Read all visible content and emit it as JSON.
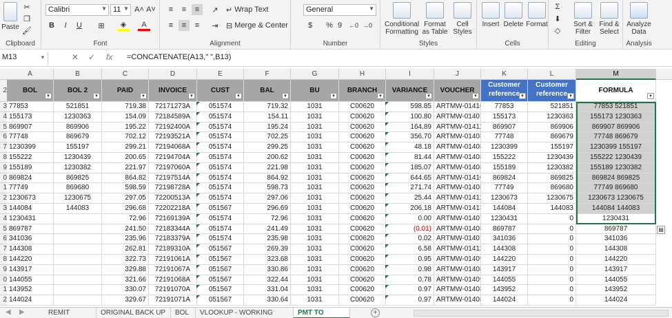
{
  "ribbon": {
    "clipboard": {
      "paste": "Paste",
      "label": "Clipboard"
    },
    "font": {
      "name": "Calibri",
      "size": "11",
      "grow": "A˄",
      "shrink": "A˅",
      "bold": "B",
      "italic": "I",
      "underline": "U",
      "label": "Font"
    },
    "alignment": {
      "wrap": "Wrap Text",
      "merge": "Merge & Center",
      "label": "Alignment"
    },
    "number": {
      "format": "General",
      "currency": "$",
      "percent": "%",
      "comma": "9",
      "label": "Number"
    },
    "styles": {
      "conditional": "Conditional Formatting",
      "table": "Format as Table",
      "cell": "Cell Styles",
      "label": "Styles"
    },
    "cells": {
      "insert": "Insert",
      "delete": "Delete",
      "format": "Format",
      "label": "Cells"
    },
    "editing": {
      "sort": "Sort & Filter",
      "find": "Find & Select",
      "label": "Editing"
    },
    "analysis": {
      "analyze": "Analyze Data",
      "label": "Analysis"
    }
  },
  "formula_bar": {
    "name_box": "M13",
    "cancel": "✕",
    "enter": "✓",
    "fx": "fx",
    "formula": "=CONCATENATE(A13,\" \",B13)"
  },
  "columns": [
    "A",
    "B",
    "C",
    "D",
    "E",
    "F",
    "G",
    "H",
    "I",
    "J",
    "K",
    "L",
    "M"
  ],
  "row_numbers": [
    "2",
    "3",
    "4",
    "5",
    "6",
    "7",
    "8",
    "9",
    "0",
    "1",
    "2",
    "3",
    "4",
    "5",
    "6",
    "7",
    "8",
    "9",
    "0",
    "1",
    "2"
  ],
  "headers": [
    "BOL",
    "BOL 2",
    "PAID",
    "INVOICE",
    "CUST",
    "BAL",
    "BU",
    "BRANCH",
    "VARIANCE",
    "VOUCHER",
    "Customer reference",
    "Customer reference",
    "FORMULA"
  ],
  "rows": [
    [
      "77853",
      "521851",
      "719.38",
      "72171273A",
      "051574",
      "719.32",
      "1031",
      "C00620",
      "598.85",
      "ARTMW-014165",
      "77853",
      "521851",
      "77853 521851"
    ],
    [
      "155173",
      "1230363",
      "154.09",
      "72184589A",
      "051574",
      "154.11",
      "1031",
      "C00620",
      "100.80",
      "ARTMW-014079",
      "155173",
      "1230363",
      "155173 1230363"
    ],
    [
      "869907",
      "869906",
      "195.22",
      "72192400A",
      "051574",
      "195.24",
      "1031",
      "C00620",
      "164.89",
      "ARTMW-014115",
      "869907",
      "869906",
      "869907 869906"
    ],
    [
      "77748",
      "869679",
      "702.12",
      "72193521A",
      "051574",
      "702.25",
      "1031",
      "C00620",
      "356.70",
      "ARTMW-014081",
      "77748",
      "869679",
      "77748 869679"
    ],
    [
      "1230399",
      "155197",
      "299.21",
      "72194068A",
      "051574",
      "299.25",
      "1031",
      "C00620",
      "48.18",
      "ARTMW-014081",
      "1230399",
      "155197",
      "1230399 155197"
    ],
    [
      "155222",
      "1230439",
      "200.65",
      "72194704A",
      "051574",
      "200.62",
      "1031",
      "C00620",
      "81.44",
      "ARTMW-014081",
      "155222",
      "1230439",
      "155222 1230439"
    ],
    [
      "155189",
      "1230382",
      "221.97",
      "72197060A",
      "051574",
      "221.98",
      "1031",
      "C00620",
      "185.07",
      "ARTMW-014082",
      "155189",
      "1230382",
      "155189 1230382"
    ],
    [
      "869824",
      "869825",
      "864.82",
      "72197514A",
      "051574",
      "864.92",
      "1031",
      "C00620",
      "644.65",
      "ARTMW-014102",
      "869824",
      "869825",
      "869824 869825"
    ],
    [
      "77749",
      "869680",
      "598.59",
      "72198728A",
      "051574",
      "598.73",
      "1031",
      "C00620",
      "271.74",
      "ARTMW-014084",
      "77749",
      "869680",
      "77749 869680"
    ],
    [
      "1230673",
      "1230675",
      "297.05",
      "72200513A",
      "051574",
      "297.06",
      "1031",
      "C00620",
      "25.44",
      "ARTMW-014116",
      "1230673",
      "1230675",
      "1230673 1230675"
    ],
    [
      "144084",
      "144083",
      "296.68",
      "72202218A",
      "051567",
      "296.69",
      "1031",
      "C00620",
      "206.18",
      "ARTMW-014135",
      "144084",
      "144083",
      "144084 144083"
    ],
    [
      "1230431",
      "",
      "72.96",
      "72169139A",
      "051574",
      "72.96",
      "1031",
      "C00620",
      "0.00",
      "ARTMW-014078",
      "1230431",
      "0",
      "1230431"
    ],
    [
      "869787",
      "",
      "241.50",
      "72183344A",
      "051574",
      "241.49",
      "1031",
      "C00620",
      "(0.01)",
      "ARTMW-014089",
      "869787",
      "0",
      "869787"
    ],
    [
      "341036",
      "",
      "235.96",
      "72183379A",
      "051574",
      "235.98",
      "1031",
      "C00620",
      "0.02",
      "ARTMW-014079",
      "341036",
      "0",
      "341036"
    ],
    [
      "144308",
      "",
      "262.81",
      "72189310A",
      "051567",
      "269.39",
      "1031",
      "C00620",
      "6.58",
      "ARTMW-014115",
      "144308",
      "0",
      "144308"
    ],
    [
      "144220",
      "",
      "322.73",
      "72191061A",
      "051567",
      "323.68",
      "1031",
      "C00620",
      "0.95",
      "ARTMW-014090",
      "144220",
      "0",
      "144220"
    ],
    [
      "143917",
      "",
      "329.88",
      "72191067A",
      "051567",
      "330.86",
      "1031",
      "C00620",
      "0.98",
      "ARTMW-014080",
      "143917",
      "0",
      "143917"
    ],
    [
      "144055",
      "",
      "321.66",
      "72191068A",
      "051567",
      "322.44",
      "1031",
      "C00620",
      "0.78",
      "ARTMW-014090",
      "144055",
      "0",
      "144055"
    ],
    [
      "143952",
      "",
      "330.07",
      "72191070A",
      "051567",
      "331.04",
      "1031",
      "C00620",
      "0.97",
      "ARTMW-014080",
      "143952",
      "0",
      "143952"
    ],
    [
      "144024",
      "",
      "329.67",
      "72191071A",
      "051567",
      "330.64",
      "1031",
      "C00620",
      "0.97",
      "ARTMW-014080",
      "144024",
      "0",
      "144024"
    ]
  ],
  "tabs": [
    "REMIT FROM",
    "ORIGINAL BACK UP",
    "BOL",
    "VLOOKUP - WORKING COPY",
    "PMT TO APPLY"
  ],
  "active_tab": "PMT TO APPLY",
  "add_sheet": "+"
}
